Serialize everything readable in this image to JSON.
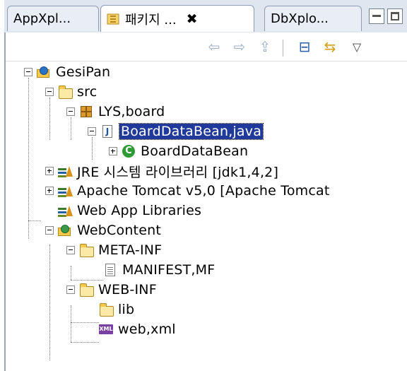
{
  "tabs": [
    {
      "label": "AppXpl...",
      "icon": "app-explorer-icon",
      "active": false
    },
    {
      "label": "패키지 ...",
      "icon": "package-explorer-icon",
      "active": true,
      "close": "✖"
    },
    {
      "label": "DbXplo...",
      "icon": "db-explorer-icon",
      "active": false
    }
  ],
  "toolbar": {
    "back": "⇦",
    "forward": "⇨",
    "up": "⇪",
    "collapse_all": "⊟",
    "link_editor": "⇆",
    "view_menu": "▽"
  },
  "tree": [
    {
      "label": "GesiPan",
      "icon": "java-project-icon"
    },
    {
      "label": "src",
      "icon": "source-folder-icon"
    },
    {
      "label": "LYS,board",
      "icon": "package-icon"
    },
    {
      "label": "BoardDataBean,java",
      "icon": "java-file-icon",
      "selected": true
    },
    {
      "label": "BoardDataBean",
      "icon": "class-icon",
      "class_glyph": "C"
    },
    {
      "label": "JRE 시스템 라이브러리 [jdk1,4,2]",
      "icon": "library-icon"
    },
    {
      "label": "Apache Tomcat v5,0 [Apache Tomcat",
      "icon": "library-icon"
    },
    {
      "label": "Web App Libraries",
      "icon": "library-icon"
    },
    {
      "label": "WebContent",
      "icon": "web-folder-icon"
    },
    {
      "label": "META-INF",
      "icon": "folder-icon"
    },
    {
      "label": "MANIFEST,MF",
      "icon": "file-icon"
    },
    {
      "label": "WEB-INF",
      "icon": "folder-icon"
    },
    {
      "label": "lib",
      "icon": "folder-icon"
    },
    {
      "label": "web,xml",
      "icon": "xml-file-icon",
      "badge": "XML"
    }
  ],
  "colors": {
    "selection": "#1f3a9a",
    "tabbar": "#dfe6f0"
  }
}
